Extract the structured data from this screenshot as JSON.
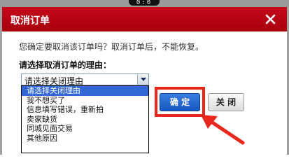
{
  "background": {
    "indicator_text": "0:0"
  },
  "dialog": {
    "title": "取消订单",
    "message": "您确定要取消该订单吗？取消订单后，不能恢复。",
    "reason_prompt": "请选择取消订单的理由：",
    "reason_select": {
      "selected": "请选择关闭理由",
      "options": [
        "请选择关闭理由",
        "我不想买了",
        "信息填写错误，重新拍",
        "卖家缺货",
        "同城见面交易",
        "其他原因"
      ]
    },
    "confirm_label": "确 定",
    "close_label": "关 闭"
  },
  "colors": {
    "titlebar": "#c5091a",
    "confirm_button": "#2a6fd8",
    "annotation": "#e8281c",
    "selected_option": "#3168d6"
  },
  "icons": {
    "close": "close-x-icon",
    "dropdown": "chevron-down-icon",
    "annotation": "arrow-annotation"
  }
}
